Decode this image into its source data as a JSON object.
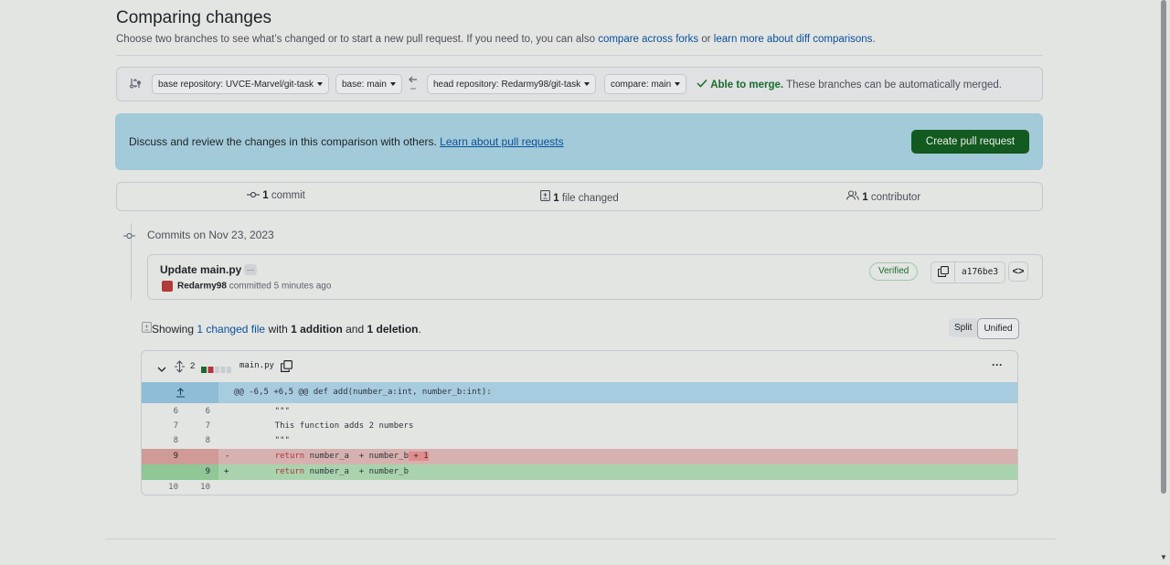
{
  "header": {
    "title": "Comparing changes",
    "subtitle_pre": "Choose two branches to see what’s changed or to start a new pull request. If you need to, you can also ",
    "link_compare_forks": "compare across forks",
    "subtitle_or": " or ",
    "link_learn_diff": "learn more about diff comparisons",
    "subtitle_end": "."
  },
  "compare": {
    "base_repo": "base repository: UVCE-Marvel/git-task",
    "base_branch": "base: main",
    "head_repo": "head repository: Redarmy98/git-task",
    "compare_branch": "compare: main",
    "merge_status": "Able to merge.",
    "merge_detail": "These branches can be automatically merged."
  },
  "banner": {
    "text": "Discuss and review the changes in this comparison with others.",
    "link": "Learn about pull requests",
    "button": "Create pull request"
  },
  "stats": {
    "commits_count": "1",
    "commits_label": "commit",
    "files_count": "1",
    "files_label": "file changed",
    "contributors_count": "1",
    "contributors_label": "contributor"
  },
  "timeline": {
    "date_label": "Commits on Nov 23, 2023",
    "commit": {
      "title": "Update main.py",
      "ellipsis": "…",
      "author": "Redarmy98",
      "meta": "committed 5 minutes ago",
      "verified": "Verified",
      "sha": "a176be3",
      "browse": "<>"
    }
  },
  "summary": {
    "prefix": "Showing ",
    "files_link": "1 changed file",
    "mid": " with ",
    "additions": "1 addition",
    "and": " and ",
    "deletions": "1 deletion",
    "end": ".",
    "split": "Split",
    "unified": "Unified"
  },
  "diff": {
    "changes_count": "2",
    "filename": "main.py",
    "menu": "···",
    "hunk_header": "@@ -6,5 +6,5 @@ def add(number_a:int, number_b:int):",
    "lines": [
      {
        "old": "6",
        "new": "6",
        "sign": "",
        "code": "    \"\"\""
      },
      {
        "old": "7",
        "new": "7",
        "sign": "",
        "code": "    This function adds 2 numbers"
      },
      {
        "old": "8",
        "new": "8",
        "sign": "",
        "code": "    \"\"\""
      },
      {
        "old": "9",
        "new": "",
        "sign": "-",
        "code_kw": "return",
        "code_rest": " number_a  + number_b",
        "code_hl": " + 1"
      },
      {
        "old": "",
        "new": "9",
        "sign": "+",
        "code_kw": "return",
        "code_rest": " number_a  + number_b"
      },
      {
        "old": "10",
        "new": "10",
        "sign": "",
        "code": ""
      }
    ]
  }
}
